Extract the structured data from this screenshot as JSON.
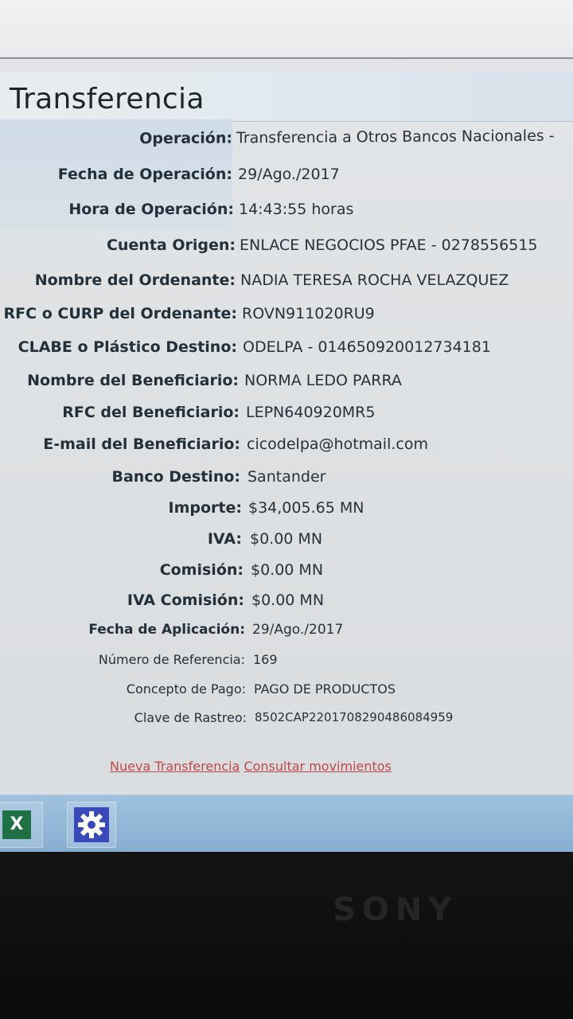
{
  "page": {
    "title": "Transferencia"
  },
  "details": [
    {
      "label": "Operación:",
      "value": "Transferencia a Otros Bancos Nacionales -"
    },
    {
      "label": "Fecha de Operación:",
      "value": "29/Ago./2017"
    },
    {
      "label": "Hora de Operación:",
      "value": "14:43:55 horas"
    },
    {
      "label": "Cuenta Origen:",
      "value": "ENLACE NEGOCIOS PFAE - 0278556515"
    },
    {
      "label": "Nombre del Ordenante:",
      "value": "NADIA TERESA ROCHA VELAZQUEZ"
    },
    {
      "label": "RFC o CURP del Ordenante:",
      "value": "ROVN911020RU9"
    },
    {
      "label": "CLABE o Plástico Destino:",
      "value": "ODELPA - 014650920012734181"
    },
    {
      "label": "Nombre del Beneficiario:",
      "value": "NORMA LEDO PARRA"
    },
    {
      "label": "RFC del Beneficiario:",
      "value": "LEPN640920MR5"
    },
    {
      "label": "E-mail del Beneficiario:",
      "value": "cicodelpa@hotmail.com"
    },
    {
      "label": "Banco Destino:",
      "value": "Santander"
    },
    {
      "label": "Importe:",
      "value": "$34,005.65 MN"
    },
    {
      "label": "IVA:",
      "value": "$0.00 MN"
    },
    {
      "label": "Comisión:",
      "value": "$0.00 MN"
    },
    {
      "label": "IVA Comisión:",
      "value": "$0.00 MN"
    },
    {
      "label": "Fecha de Aplicación:",
      "value": "29/Ago./2017"
    },
    {
      "label": "Número de Referencia:",
      "value": "169"
    },
    {
      "label": "Concepto de Pago:",
      "value": "PAGO DE PRODUCTOS"
    },
    {
      "label": "Clave de Rastreo:",
      "value": "8502CAP2201708290486084959"
    }
  ],
  "links": {
    "new_transfer": "Nueva Transferencia",
    "view_movements": "Consultar movimientos"
  },
  "taskbar": {
    "excel_icon_glyph": "X",
    "excel_icon": "excel-icon",
    "settings_icon": "gear-icon"
  },
  "device": {
    "brand": "SONY"
  },
  "colors": {
    "link": "#c0474a",
    "taskbar": "#8fb4d4",
    "excel": "#1e7145",
    "settings": "#3a49b8"
  }
}
